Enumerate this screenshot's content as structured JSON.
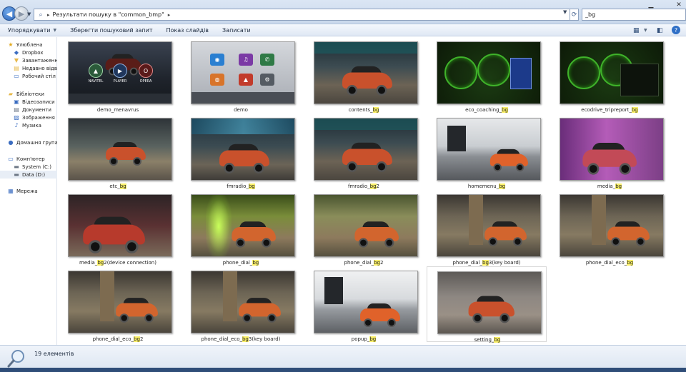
{
  "window": {
    "address_path": "Результати пошуку в \"common_bmp\"",
    "search_value": "_bg",
    "minimize_glyph": "▁",
    "close_glyph": "✕"
  },
  "toolbar": {
    "organize": "Упорядкувати",
    "save_search": "Зберегти пошуковий запит",
    "slideshow": "Показ слайдів",
    "burn": "Записати"
  },
  "sidebar": {
    "favorites": {
      "title": "Улюблена",
      "items": [
        "Dropbox",
        "Завантаження",
        "Недавно відві",
        "Робочий стіл"
      ]
    },
    "libraries": {
      "title": "Бібліотеки",
      "items": [
        "Відеозаписи",
        "Документи",
        "Зображення",
        "Музика"
      ]
    },
    "homegroup": "Домашня група",
    "computer": {
      "title": "Комп'ютер",
      "items": [
        "System (C:)",
        "Data (D:)"
      ]
    },
    "network": "Мережа"
  },
  "files": [
    {
      "pre": "demo_menavrus",
      "hl": "",
      "post": "",
      "thumb": "menu-nav"
    },
    {
      "pre": "demo",
      "hl": "",
      "post": "",
      "thumb": "menu-grid"
    },
    {
      "pre": "contents_",
      "hl": "bg",
      "post": "",
      "thumb": "bridge-dark"
    },
    {
      "pre": "eco_coaching_",
      "hl": "bg",
      "post": "",
      "thumb": "gauges"
    },
    {
      "pre": "ecodrive_tripreport_",
      "hl": "bg",
      "post": "",
      "thumb": "gauges-panel"
    },
    {
      "pre": "etc_",
      "hl": "bg",
      "post": "",
      "thumb": "bridge-side"
    },
    {
      "pre": "fmradio_",
      "hl": "bg",
      "post": "",
      "thumb": "bridge-blue"
    },
    {
      "pre": "fmradio_",
      "hl": "bg",
      "post": "2",
      "thumb": "bridge-dark"
    },
    {
      "pre": "homemenu_",
      "hl": "bg",
      "post": "",
      "thumb": "monument"
    },
    {
      "pre": "media_",
      "hl": "bg",
      "post": "",
      "thumb": "purple"
    },
    {
      "pre": "media_",
      "hl": "bg",
      "post": "2(device connection)",
      "thumb": "red-closeup"
    },
    {
      "pre": "phone_dial_",
      "hl": "bg",
      "post": "",
      "thumb": "green-glow"
    },
    {
      "pre": "phone_dial_",
      "hl": "bg",
      "post": "2",
      "thumb": "green-soft"
    },
    {
      "pre": "phone_dial_",
      "hl": "bg",
      "post": "3(key board)",
      "thumb": "dark-column"
    },
    {
      "pre": "phone_dial_eco_",
      "hl": "bg",
      "post": "",
      "thumb": "dark-column"
    },
    {
      "pre": "phone_dial_eco_",
      "hl": "bg",
      "post": "2",
      "thumb": "dark-column"
    },
    {
      "pre": "phone_dial_eco_",
      "hl": "bg",
      "post": "3(key board)",
      "thumb": "dark-column"
    },
    {
      "pre": "popup_",
      "hl": "bg",
      "post": "",
      "thumb": "monument-light"
    },
    {
      "pre": "setting_",
      "hl": "bg",
      "post": "",
      "thumb": "grey-car"
    }
  ],
  "status": {
    "count": "19 елементів"
  }
}
